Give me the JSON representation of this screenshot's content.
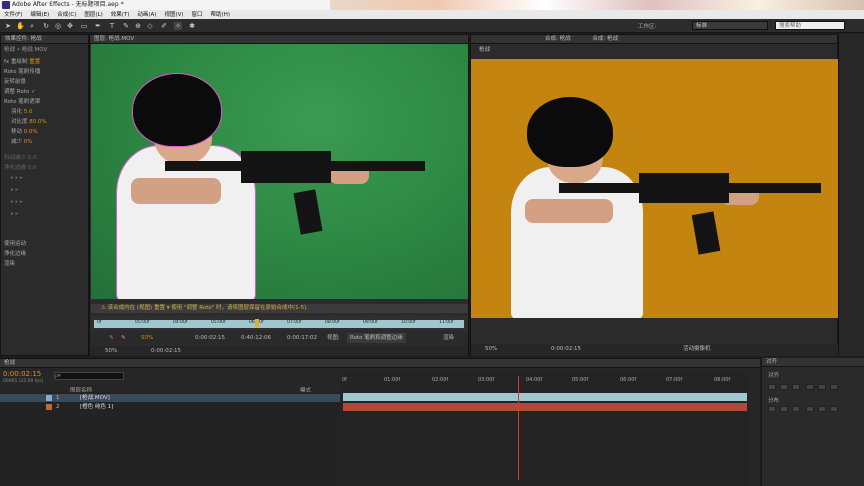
{
  "title_bar": {
    "text": "Adobe After Effects - 无标题项目.aep *"
  },
  "menu": [
    "文件(F)",
    "编辑(E)",
    "合成(C)",
    "图层(L)",
    "效果(T)",
    "动画(A)",
    "视图(V)",
    "窗口",
    "帮助(H)"
  ],
  "workspace": {
    "label": "工作区:",
    "value": "标准",
    "search_placeholder": "搜索帮助"
  },
  "left_panel": {
    "tab": "效果控件: 枪战",
    "subtitle": "枪战 • 枪战.MOV",
    "rows": [
      {
        "text": "fx 重绘制",
        "value": "重置"
      },
      {
        "text": "Roto 笔刷传播"
      },
      {
        "text": "反转前景"
      },
      {
        "text": "调整 Roto",
        "value": "✓"
      },
      {
        "text": "Roto 笔刷遮罩"
      },
      {
        "text": "羽化",
        "value": "5.0"
      },
      {
        "text": "对比度",
        "value": "80.0%"
      },
      {
        "text": "移动",
        "value": "0.0%"
      },
      {
        "text": "减少",
        "value": "0%"
      },
      {
        "text": "抖动减少",
        "value": "0.0"
      },
      {
        "text": "净化边缘",
        "value": "0.0"
      },
      {
        "text": "使用运动"
      },
      {
        "text": "净化边缘"
      },
      {
        "text": "渲染"
      }
    ]
  },
  "left_viewer": {
    "tab": "图层: 枪战.MOV",
    "status": "⚠ 该合成内在 (视图) 重置 ▾ 使用 \"调整 Roto\" 时，请将图层保留在原始合成中(1-5).",
    "ruler": [
      "0f",
      "05:00f",
      "04:00f",
      "05:00f",
      "06:00f",
      "07:00f",
      "08:00f",
      "09:00f",
      "10:00f",
      "11:00f"
    ],
    "zoom": "50%",
    "timecode": "0:00:02:15",
    "fps": "0:40:12:06",
    "duration": "0:00:17:02",
    "view_label": "视图:",
    "view_value": "Roto 笔刷和调整边缘",
    "render": "渲染"
  },
  "right_viewer": {
    "tabs": [
      "合成: 枪战",
      "合成: 枪战"
    ],
    "subtab": "枪战",
    "zoom": "50%",
    "timecode": "0:00:02:15",
    "extra": "活动摄像机"
  },
  "timeline": {
    "tab": "枪战",
    "timecode": "0:00:02:15",
    "fps_note": "00065 (25.00 fps)",
    "search_placeholder": "ρ▾",
    "col_layer": "图层名称",
    "col_mode": "模式",
    "layers": [
      {
        "index": "1",
        "name": "[枪战.MOV]",
        "color": "#7fb0d4"
      },
      {
        "index": "2",
        "name": "[橙色 纯色 1]",
        "color": "#c06a3c"
      }
    ],
    "ruler": [
      "0f",
      "01:00f",
      "02:00f",
      "03:00f",
      "04:00f",
      "05:00f",
      "06:00f",
      "07:00f",
      "08:00f"
    ]
  },
  "align_panel": {
    "tab": "对齐",
    "label_1": "对齐",
    "label_2": "分布"
  },
  "colors": {
    "green_screen": "#2e8a44",
    "orange_bg": "#c48410",
    "accent_orange": "#d9941a",
    "playhead": "#e0362a"
  }
}
